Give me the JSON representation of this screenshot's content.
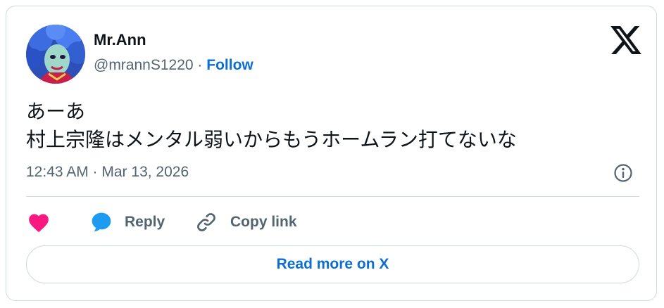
{
  "author": {
    "name": "Mr.Ann",
    "handle": "@mrannS1220",
    "separator": "·",
    "follow_label": "Follow",
    "avatar_icon": "avatar-illustration"
  },
  "brand": {
    "logo_icon": "x-logo-icon"
  },
  "tweet": {
    "line1": "あーあ",
    "line2": "村上宗隆はメンタル弱いからもうホームラン打てないな"
  },
  "meta": {
    "timestamp": "12:43 AM · Mar 13, 2026",
    "info_icon": "info-icon"
  },
  "actions": {
    "like_icon": "heart-icon",
    "reply_label": "Reply",
    "reply_icon": "speech-bubble-icon",
    "copy_label": "Copy link",
    "copy_icon": "link-icon"
  },
  "read_more_label": "Read more on X",
  "colors": {
    "accent": "#0b6ed0",
    "like": "#f91880",
    "reply": "#1d9bf0",
    "muted": "#536471",
    "border": "#cfd9de"
  }
}
